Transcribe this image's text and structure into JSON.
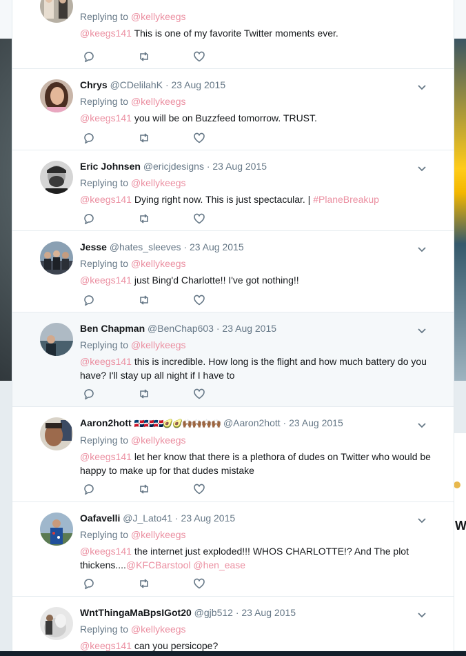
{
  "replying_label": "Replying to",
  "replying_handle": "@kellykeegs",
  "mention": "@keegs141",
  "colors": {
    "mention": "#eb8fa1",
    "meta": "#657786",
    "text": "#14171a"
  },
  "replies": [
    {
      "name": "",
      "handle": "",
      "date": "",
      "text": "This is one of my favorite Twitter moments ever.",
      "extra": ""
    },
    {
      "name": "Chrys",
      "handle": "@CDelilahK",
      "date": "· 23 Aug 2015",
      "text": "you will be on Buzzfeed tomorrow. TRUST.",
      "extra": ""
    },
    {
      "name": "Eric Johnsen",
      "handle": "@ericjdesigns",
      "date": "· 23 Aug 2015",
      "text": "Dying right now. This is just spectacular. |",
      "extra": "#PlaneBreakup"
    },
    {
      "name": "Jesse",
      "handle": "@hates_sleeves",
      "date": "· 23 Aug 2015",
      "text": "just Bing'd Charlotte!!  I've got nothing!!",
      "extra": ""
    },
    {
      "name": "Ben Chapman",
      "handle": "@BenChap603",
      "date": "· 23 Aug 2015",
      "text": "this is incredible. How long is the flight and how much battery do you have? I'll stay up all night if I have to",
      "extra": ""
    },
    {
      "name": "Aaron2hott",
      "name_emoji": "🇩🇴🇩🇴🇩🇴🥑🥑🙌🏾🙌🏾🙌🏾🙌🏾",
      "handle": "@Aaron2hott",
      "date": "· 23 Aug 2015",
      "text": "let her know that there is a plethora of dudes on Twitter who would be happy to make up for that dudes mistake",
      "extra": ""
    },
    {
      "name": "Oafavelli",
      "handle": "@J_Lato41",
      "date": "· 23 Aug 2015",
      "text": "the internet just exploded!!! WHOS CHARLOTTE!? And The plot thickens....",
      "extra": "@KFCBarstool @hen_ease"
    },
    {
      "name": "WntThingaMaBpsIGot20",
      "handle": "@gjb512",
      "date": "· 23 Aug 2015",
      "text": "can you persicope?",
      "extra": ""
    }
  ],
  "background": {
    "partial_heading": "W"
  },
  "icons": {
    "reply": "reply-icon",
    "retweet": "retweet-icon",
    "like": "heart-icon",
    "more": "chevron-down-icon"
  }
}
